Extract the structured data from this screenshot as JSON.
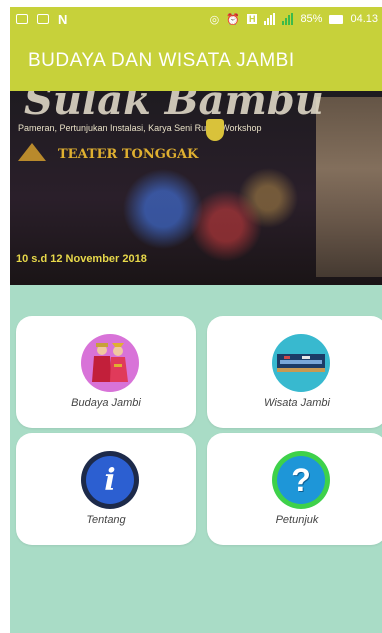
{
  "status_bar": {
    "battery": "85%",
    "time": "04.13",
    "carrier_glyph": "N",
    "network_badge": "H"
  },
  "app_bar": {
    "title": "BUDAYA DAN WISATA JAMBI"
  },
  "banner": {
    "headline": "Sulak Bambu",
    "subtitle": "Pameran, Pertunjukan Instalasi, Karya Seni Rupa, Workshop",
    "organizer": "TEATER TONGGAK",
    "date": "10 s.d 12 November 2018",
    "slide_count": 4,
    "active_slide": 3
  },
  "menu": [
    {
      "label": "Budaya Jambi",
      "icon": "traditional-costume-icon"
    },
    {
      "label": "Wisata Jambi",
      "icon": "landmark-photo-icon"
    },
    {
      "label": "Tentang",
      "icon": "info-icon"
    },
    {
      "label": "Petunjuk",
      "icon": "help-question-icon"
    }
  ],
  "colors": {
    "primary": "#c7d13a",
    "background": "#a9dcc6",
    "card": "#ffffff"
  }
}
